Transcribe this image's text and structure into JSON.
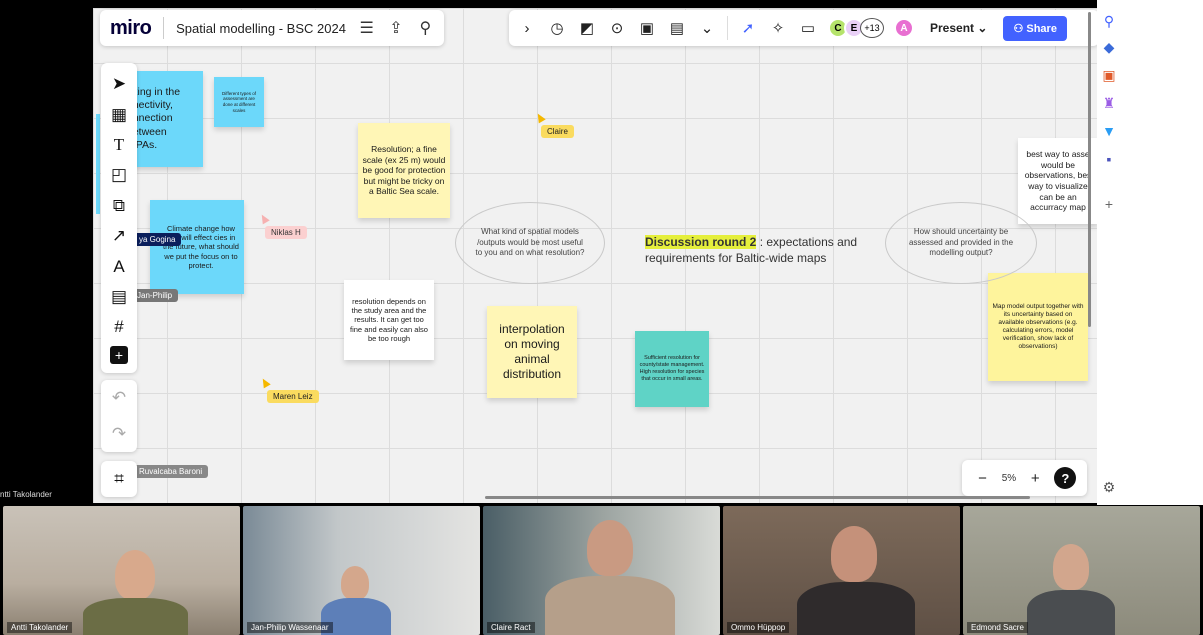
{
  "app": {
    "logo": "miro",
    "board_title": "Spatial modelling - BSC 2024",
    "present_label": "Present",
    "share_label": "Share",
    "collaborator_count": "+13",
    "avatars": [
      "C",
      "E",
      "A"
    ]
  },
  "colors": {
    "share_button": "#4262ff",
    "sticky_blue": "#6cd8fa",
    "sticky_yellow": "#fff6b6",
    "sticky_teal": "#5fd3c6",
    "highlight": "#e5ef3c"
  },
  "icons": {
    "board_panel": [
      "menu-icon",
      "export-icon",
      "search-icon"
    ],
    "toolbar": [
      "chevron-right-icon",
      "timer-icon",
      "reactions-icon",
      "focus-icon",
      "number-icon",
      "notes-icon",
      "more-icon",
      "cursor-icon",
      "celebrate-icon",
      "comment-icon"
    ],
    "left_toolbar": [
      "select-icon",
      "templates-icon",
      "text-icon",
      "sticky-note-icon",
      "shapes-icon",
      "arrow-icon",
      "pen-icon",
      "comment-icon",
      "frame-icon",
      "add-icon"
    ],
    "right_rail": [
      "search-icon",
      "tag-icon",
      "apps-icon",
      "integrations-icon",
      "cart-icon",
      "teams-icon",
      "plus-icon",
      "settings-icon"
    ]
  },
  "zoom": {
    "level": "5%"
  },
  "board": {
    "heading": {
      "highlight": "Discussion round 2",
      "rest": " : expectations and requirements for Baltic-wide maps"
    },
    "ovals": [
      "What kind of spatial models /outputs would be most useful to you and on what resolution?",
      "How should uncertainty be assessed and provided in the modelling output?"
    ],
    "stickies": {
      "connectivity": "cking in the nnectivity, onnection between MPAs.",
      "assessments": "Different types of assessment are done at different scales",
      "resolution": "Resolution; a fine scale (ex 25 m) would be good for protection but might be tricky on a Baltic Sea scale.",
      "climate": "Climate change how that will effect cies in the future, what should we put the focus on to protect.",
      "resolution_depends": "resolution depends on the study area and the results. It can get too fine and easily can also be too rough",
      "interpolation": "interpolation on moving animal distribution",
      "sufficient": "Sufficient resolution for county/state management. High resolution for species that occur in small areas.",
      "best_way": "best way to asse would be observations, bes way to visualize can be an accurracy map",
      "map_model": "Map model output together with its uncertainty based on available observations (e.g. calculating errors, model verification, show lack of observations)"
    },
    "cursors": [
      "Claire",
      "Niklas H",
      "Maren Leiz",
      "Jan-Philip",
      "ya Gogina",
      "Ruvalcaba Baroni"
    ]
  },
  "presenter_label": "ntti Takolander",
  "participants": [
    {
      "name": "Antti Takolander"
    },
    {
      "name": "Jan-Philip Wassenaar"
    },
    {
      "name": "Claire Ract"
    },
    {
      "name": "Ommo Hüppop"
    },
    {
      "name": "Edmond Sacre"
    }
  ]
}
